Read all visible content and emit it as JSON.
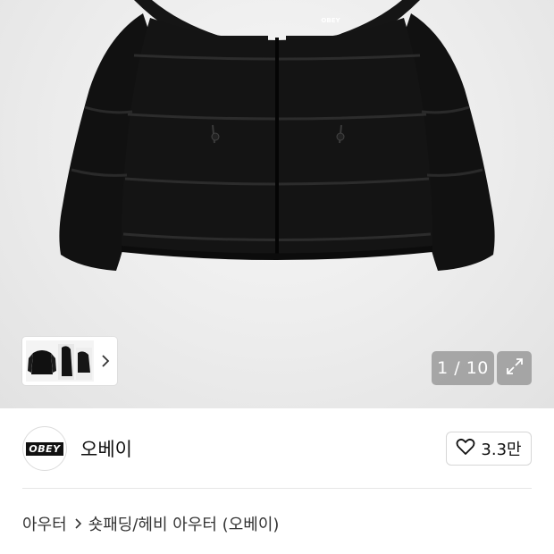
{
  "gallery": {
    "counter": "1 / 10",
    "product_brand_mark": "OBEY"
  },
  "brand": {
    "logo_text": "OBEY",
    "name": "오베이",
    "likes": "3.3만"
  },
  "breadcrumb": {
    "root": "아우터",
    "category": "숏패딩/헤비 아우터 (오베이)"
  },
  "icons": {
    "thumbnail_next": "chevron-right-icon",
    "expand": "expand-icon",
    "like": "heart-icon",
    "breadcrumb_separator": "chevron-right-icon"
  }
}
